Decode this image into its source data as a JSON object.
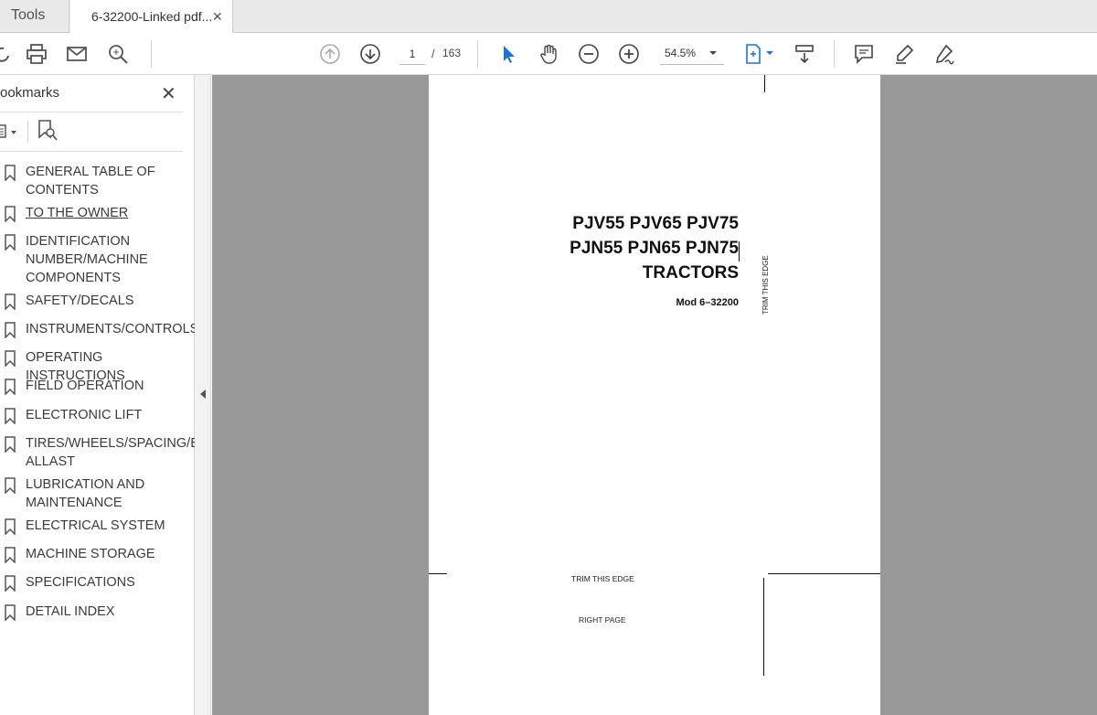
{
  "tabs": {
    "tools_label": "Tools",
    "document_label": "6-32200-Linked pdf...",
    "close_glyph": "✕"
  },
  "toolbar": {
    "current_page": "1",
    "page_separator": "/",
    "total_pages": "163",
    "zoom": "54.5%",
    "icons": [
      "share-icon",
      "print-icon",
      "email-icon",
      "search-icon",
      "page-up-icon",
      "page-down-icon",
      "select-cursor-icon",
      "hand-tool-icon",
      "zoom-out-icon",
      "zoom-in-icon",
      "fit-page-icon",
      "scroll-mode-icon",
      "comment-icon",
      "highlight-icon",
      "sign-icon"
    ],
    "accent_color": "#1473e6"
  },
  "bookmarks_panel": {
    "title": "ookmarks",
    "close_glyph": "✕",
    "items": [
      {
        "label": "GENERAL TABLE OF CONTENTS"
      },
      {
        "label": "TO THE OWNER"
      },
      {
        "label": "IDENTIFICATION NUMBER/MACHINE COMPONENTS"
      },
      {
        "label": "SAFETY/DECALS"
      },
      {
        "label": "INSTRUMENTS/CONTROLS"
      },
      {
        "label": "OPERATING INSTRUCTIONS"
      },
      {
        "label": "FIELD OPERATION"
      },
      {
        "label": "ELECTRONIC LIFT"
      },
      {
        "label": "TIRES/WHEELS/SPACING/B ALLAST"
      },
      {
        "label": "LUBRICATION AND MAINTENANCE"
      },
      {
        "label": "ELECTRICAL SYSTEM"
      },
      {
        "label": "MACHINE STORAGE"
      },
      {
        "label": "SPECIFICATIONS"
      },
      {
        "label": "DETAIL INDEX"
      }
    ]
  },
  "document": {
    "title_line1": "PJV55 PJV65 PJV75",
    "title_line2": "PJN55 PJN65 PJN75",
    "title_line3": "TRACTORS",
    "model": "Mod 6–32200",
    "trim_vertical": "TRIM THIS EDGE",
    "trim_bottom": "TRIM THIS EDGE",
    "right_page": "RIGHT PAGE"
  }
}
